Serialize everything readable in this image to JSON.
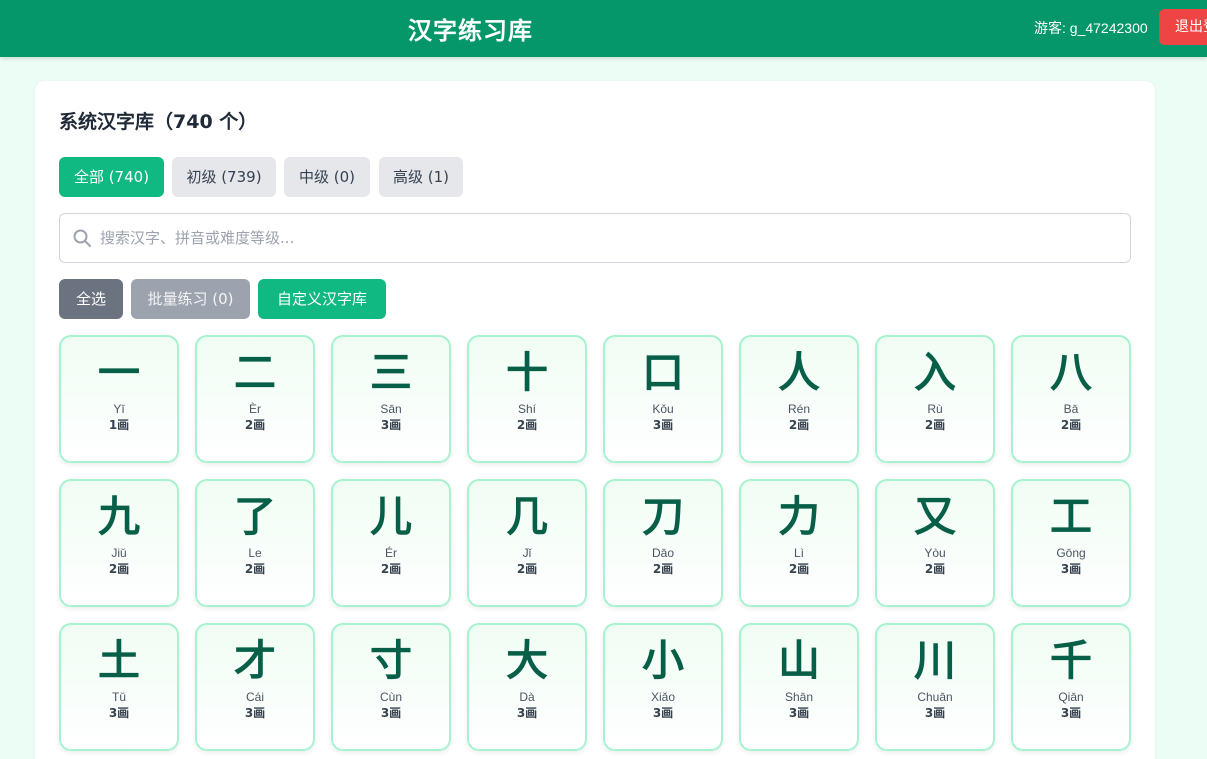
{
  "header": {
    "title": "汉字练习库",
    "user_label": "游客: g_47242300",
    "logout_label": "退出登录"
  },
  "library": {
    "title": "系统汉字库（740 个）",
    "filters": [
      {
        "label": "全部 (740)",
        "active": true
      },
      {
        "label": "初级 (739)",
        "active": false
      },
      {
        "label": "中级 (0)",
        "active": false
      },
      {
        "label": "高级 (1)",
        "active": false
      }
    ],
    "search_placeholder": "搜索汉字、拼音或难度等级...",
    "search_value": "",
    "actions": {
      "select_all": "全选",
      "batch_practice": "批量练习 (0)",
      "custom_library": "自定义汉字库"
    },
    "characters": [
      {
        "char": "一",
        "pinyin": "Yī",
        "strokes": "1画"
      },
      {
        "char": "二",
        "pinyin": "Èr",
        "strokes": "2画"
      },
      {
        "char": "三",
        "pinyin": "Sān",
        "strokes": "3画"
      },
      {
        "char": "十",
        "pinyin": "Shí",
        "strokes": "2画"
      },
      {
        "char": "口",
        "pinyin": "Kǒu",
        "strokes": "3画"
      },
      {
        "char": "人",
        "pinyin": "Rén",
        "strokes": "2画"
      },
      {
        "char": "入",
        "pinyin": "Rù",
        "strokes": "2画"
      },
      {
        "char": "八",
        "pinyin": "Bā",
        "strokes": "2画"
      },
      {
        "char": "九",
        "pinyin": "Jiǔ",
        "strokes": "2画"
      },
      {
        "char": "了",
        "pinyin": "Le",
        "strokes": "2画"
      },
      {
        "char": "儿",
        "pinyin": "Ér",
        "strokes": "2画"
      },
      {
        "char": "几",
        "pinyin": "Jǐ",
        "strokes": "2画"
      },
      {
        "char": "刀",
        "pinyin": "Dāo",
        "strokes": "2画"
      },
      {
        "char": "力",
        "pinyin": "Lì",
        "strokes": "2画"
      },
      {
        "char": "又",
        "pinyin": "Yòu",
        "strokes": "2画"
      },
      {
        "char": "工",
        "pinyin": "Gōng",
        "strokes": "3画"
      },
      {
        "char": "土",
        "pinyin": "Tǔ",
        "strokes": "3画"
      },
      {
        "char": "才",
        "pinyin": "Cái",
        "strokes": "3画"
      },
      {
        "char": "寸",
        "pinyin": "Cùn",
        "strokes": "3画"
      },
      {
        "char": "大",
        "pinyin": "Dà",
        "strokes": "3画"
      },
      {
        "char": "小",
        "pinyin": "Xiǎo",
        "strokes": "3画"
      },
      {
        "char": "山",
        "pinyin": "Shān",
        "strokes": "3画"
      },
      {
        "char": "川",
        "pinyin": "Chuān",
        "strokes": "3画"
      },
      {
        "char": "千",
        "pinyin": "Qiān",
        "strokes": "3画"
      }
    ]
  }
}
